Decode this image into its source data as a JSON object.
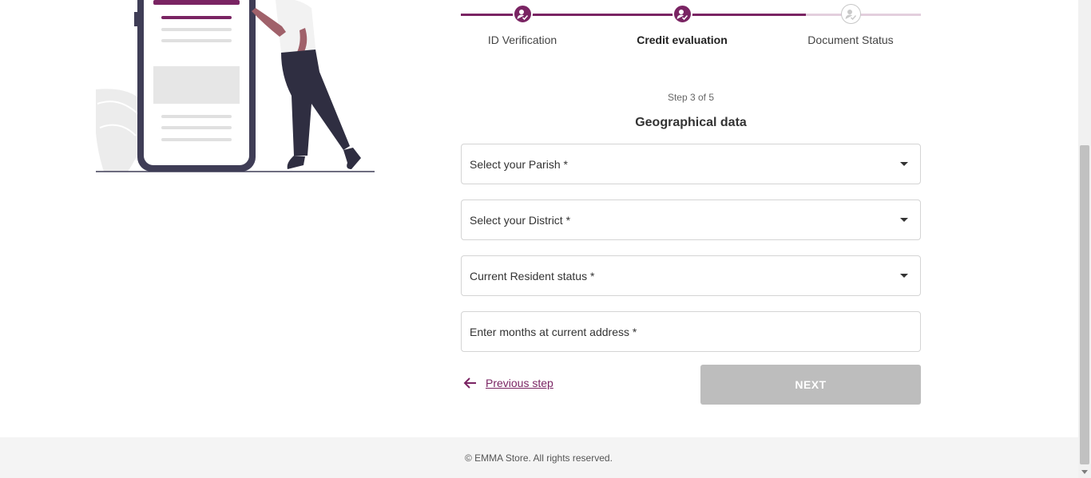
{
  "stepper": {
    "steps": [
      {
        "label": "ID Verification",
        "state": "done",
        "icon": "user-check-icon"
      },
      {
        "label": "Credit evaluation",
        "state": "current",
        "icon": "user-check-icon"
      },
      {
        "label": "Document Status",
        "state": "pending",
        "icon": "user-check-icon"
      }
    ]
  },
  "form": {
    "step_count": "Step 3 of 5",
    "title": "Geographical data",
    "parish_placeholder": "Select your Parish *",
    "district_placeholder": "Select your District *",
    "resident_placeholder": "Current Resident status *",
    "months_placeholder": "Enter months at current address *",
    "previous_label": "Previous step",
    "next_label": "NEXT"
  },
  "footer": {
    "copyright": "© EMMA Store. All rights reserved."
  },
  "colors": {
    "accent": "#7a2463",
    "accent_light": "#e3cfdd",
    "disabled_button": "#bdbdbd",
    "footer_bg": "#f4f4f4"
  }
}
